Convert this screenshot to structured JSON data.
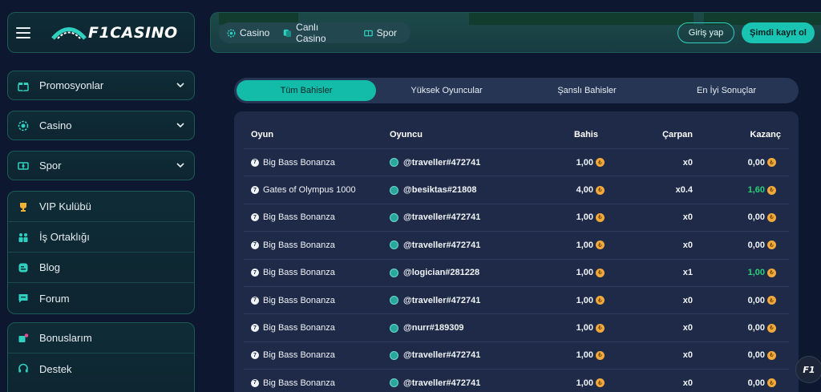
{
  "brand": {
    "logo_text": "F1CASINO"
  },
  "sidebar": {
    "accordions": [
      {
        "label": "Promosyonlar",
        "icon": "gift-icon"
      },
      {
        "label": "Casino",
        "icon": "chip-icon"
      },
      {
        "label": "Spor",
        "icon": "sport-icon"
      }
    ],
    "group1": [
      {
        "label": "VIP Kulübü",
        "icon": "trophy-icon"
      },
      {
        "label": "İş Ortaklığı",
        "icon": "partners-icon"
      },
      {
        "label": "Blog",
        "icon": "blog-icon"
      },
      {
        "label": "Forum",
        "icon": "forum-icon"
      }
    ],
    "group2": [
      {
        "label": "Bonuslarım",
        "icon": "bonus-icon"
      },
      {
        "label": "Destek",
        "icon": "support-icon"
      }
    ]
  },
  "topnav": {
    "items": [
      "Casino",
      "Canlı Casino",
      "Spor"
    ],
    "login_label": "Giriş yap",
    "register_label": "Şimdi kayıt ol"
  },
  "tabs": [
    "Tüm Bahisler",
    "Yüksek Oyuncular",
    "Şanslı Bahisler",
    "En İyi Sonuçlar"
  ],
  "table": {
    "headers": {
      "game": "Oyun",
      "player": "Oyuncu",
      "bet": "Bahis",
      "multiplier": "Çarpan",
      "win": "Kazanç"
    },
    "rows": [
      {
        "game": "Big Bass Bonanza",
        "player": "@traveller#472741",
        "bet": "1,00",
        "multiplier": "x0",
        "win": "0,00",
        "win_positive": false
      },
      {
        "game": "Gates of Olympus 1000",
        "player": "@besiktas#21808",
        "bet": "4,00",
        "multiplier": "x0.4",
        "win": "1,60",
        "win_positive": true
      },
      {
        "game": "Big Bass Bonanza",
        "player": "@traveller#472741",
        "bet": "1,00",
        "multiplier": "x0",
        "win": "0,00",
        "win_positive": false
      },
      {
        "game": "Big Bass Bonanza",
        "player": "@traveller#472741",
        "bet": "1,00",
        "multiplier": "x0",
        "win": "0,00",
        "win_positive": false
      },
      {
        "game": "Big Bass Bonanza",
        "player": "@logician#281228",
        "bet": "1,00",
        "multiplier": "x1",
        "win": "1,00",
        "win_positive": true
      },
      {
        "game": "Big Bass Bonanza",
        "player": "@traveller#472741",
        "bet": "1,00",
        "multiplier": "x0",
        "win": "0,00",
        "win_positive": false
      },
      {
        "game": "Big Bass Bonanza",
        "player": "@nurr#189309",
        "bet": "1,00",
        "multiplier": "x0",
        "win": "0,00",
        "win_positive": false
      },
      {
        "game": "Big Bass Bonanza",
        "player": "@traveller#472741",
        "bet": "1,00",
        "multiplier": "x0",
        "win": "0,00",
        "win_positive": false
      },
      {
        "game": "Big Bass Bonanza",
        "player": "@traveller#472741",
        "bet": "1,00",
        "multiplier": "x0",
        "win": "0,00",
        "win_positive": false
      }
    ]
  },
  "colors": {
    "accent": "#19c4b2",
    "win_green": "#2bd07a",
    "coin": "#f2a93b",
    "background": "#0d1830",
    "card": "#1e2a47"
  },
  "floating": {
    "label": "F1"
  }
}
